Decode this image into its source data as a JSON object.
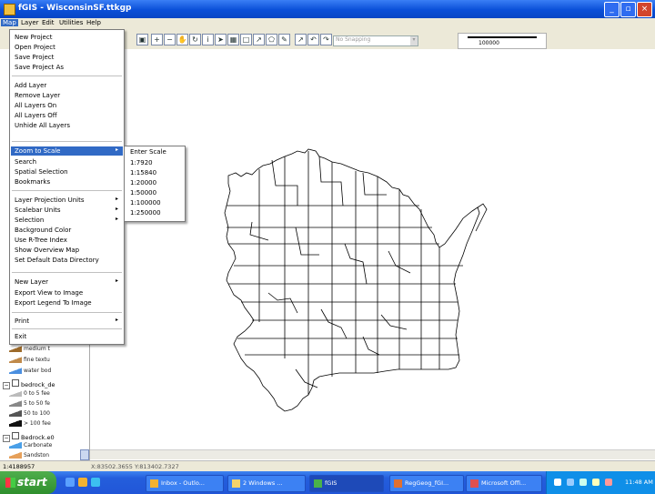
{
  "window": {
    "title": "fGIS - WisconsinSF.ttkgp"
  },
  "menubar": {
    "items": [
      "Map",
      "Layer",
      "Edit",
      "Utilities",
      "Help"
    ]
  },
  "toolbar": {
    "snapping_value": "No Snapping"
  },
  "scalebar": {
    "value": "100000"
  },
  "map_menu": {
    "new_project": "New Project",
    "open_project": "Open Project",
    "save_project": "Save Project",
    "save_project_as": "Save Project As",
    "add_layer": "Add Layer",
    "remove_layer": "Remove Layer",
    "all_layers_on": "All Layers On",
    "all_layers_off": "All Layers Off",
    "unhide_all_layers": "Unhide All Layers",
    "zoom_to_scale": "Zoom to Scale",
    "search": "Search",
    "spatial_selection": "Spatial Selection",
    "bookmarks": "Bookmarks",
    "layer_projection_units": "Layer Projection Units",
    "scalebar_units": "Scalebar Units",
    "selection": "Selection",
    "background_color": "Background Color",
    "use_rtree_index": "Use R-Tree Index",
    "show_overview_map": "Show Overview Map",
    "set_default_data_directory": "Set Default Data Directory",
    "new_layer": "New Layer",
    "export_view_to_image": "Export View to Image",
    "export_legend_to_image": "Export Legend To Image",
    "print": "Print",
    "exit": "Exit"
  },
  "zoom_submenu": {
    "enter_scale": "Enter Scale",
    "s1": "1:7920",
    "s2": "1:15840",
    "s3": "1:20000",
    "s4": "1:50000",
    "s5": "1:100000",
    "s6": "1:250000"
  },
  "legend": {
    "medium": "medium t",
    "fine": "fine textu",
    "water": "water bod",
    "bedrock_depth": "bedrock_de",
    "b0_5": "0 to 5 fee",
    "b5_50": "5 to 50 fe",
    "b50_100": "50 to 100",
    "b100": "> 100 fee",
    "bedrock_e0": "Bedrock.e0",
    "carbonate": "Carbonate",
    "sandstone": "Sandston"
  },
  "status": {
    "scale": "1:4188957",
    "coords": "X:83502.3655 Y:813402.7327"
  },
  "taskbar": {
    "start": "start",
    "tasks": [
      "Inbox - Outlo...",
      "2 Windows ...",
      "fGIS",
      "RegGeog_fGI...",
      "Microsoft Offi..."
    ],
    "clock": "11:48 AM"
  },
  "colors": {
    "title_blue": "#0a4fd8",
    "menu_highlight": "#316ac5",
    "taskbar_blue": "#245edc",
    "start_green": "#2f8f2d"
  }
}
